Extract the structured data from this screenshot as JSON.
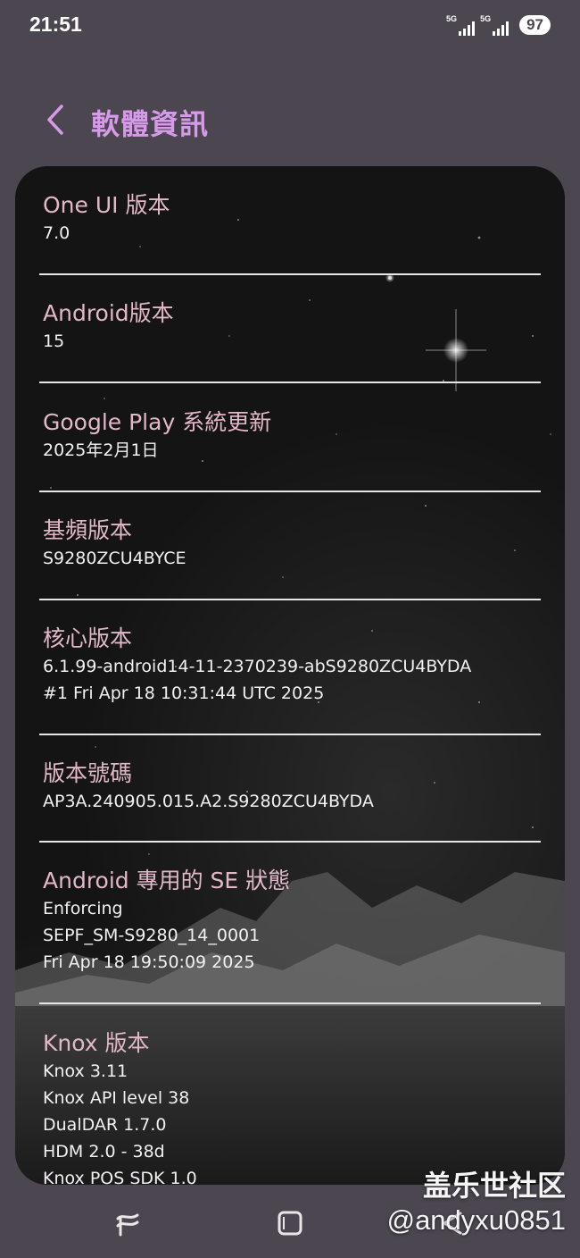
{
  "status_bar": {
    "time": "21:51",
    "network_1": "5G",
    "network_2": "5G",
    "battery": "97"
  },
  "header": {
    "title": "軟體資訊",
    "back_icon": "chevron-left-icon"
  },
  "items": [
    {
      "title": "One UI 版本",
      "values": [
        "7.0"
      ]
    },
    {
      "title": "Android版本",
      "values": [
        "15"
      ]
    },
    {
      "title": "Google Play 系統更新",
      "values": [
        "2025年2月1日"
      ]
    },
    {
      "title": "基頻版本",
      "values": [
        "S9280ZCU4BYCE"
      ]
    },
    {
      "title": "核心版本",
      "values": [
        "6.1.99-android14-11-2370239-abS9280ZCU4BYDA",
        "#1 Fri Apr 18 10:31:44 UTC 2025"
      ]
    },
    {
      "title": "版本號碼",
      "values": [
        "AP3A.240905.015.A2.S9280ZCU4BYDA"
      ]
    },
    {
      "title": "Android 專用的 SE 狀態",
      "values": [
        "Enforcing",
        "SEPF_SM-S9280_14_0001",
        "Fri Apr 18 19:50:09 2025"
      ]
    },
    {
      "title": "Knox 版本",
      "values": [
        "Knox 3.11",
        "Knox API level 38",
        "DualDAR 1.7.0",
        "HDM 2.0 - 38d",
        "Knox POS SDK 1.0"
      ]
    }
  ],
  "nav_bar": {
    "recents_icon": "recents-icon",
    "home_icon": "home-icon",
    "back_icon": "back-icon"
  },
  "watermark": {
    "site": "盖乐世社区",
    "user": "@andyxu0851"
  },
  "colors": {
    "background": "#4b4650",
    "accent": "#d79ae8",
    "item_title": "#e2b8c8"
  }
}
